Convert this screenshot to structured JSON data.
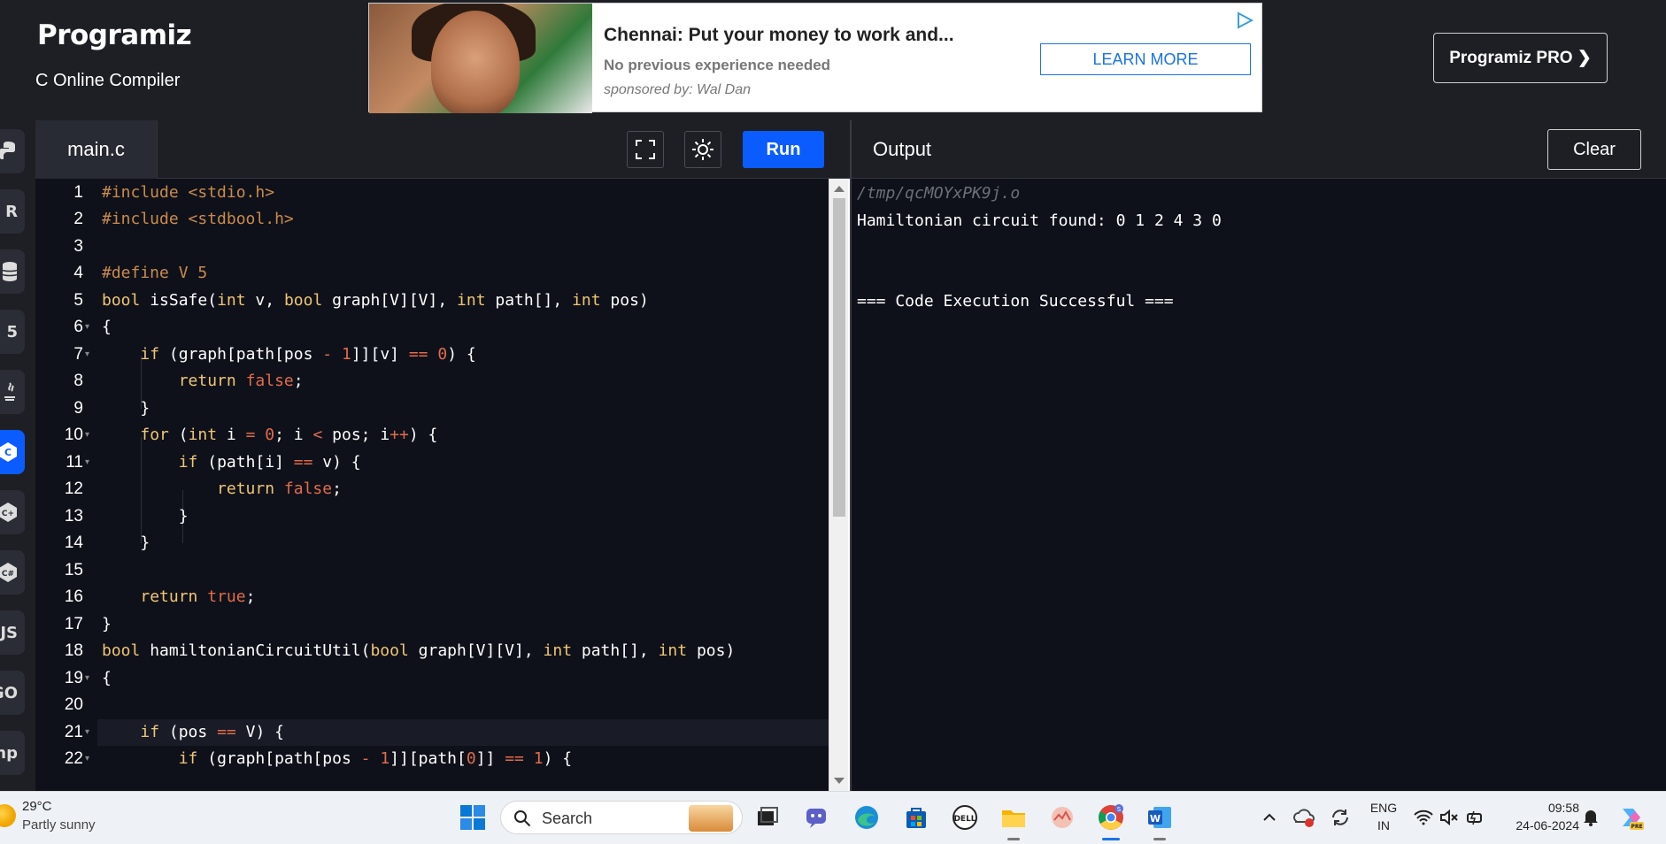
{
  "header": {
    "logo": "Programiz",
    "subtitle": "C Online Compiler",
    "pro_button": "Programiz PRO ❯"
  },
  "ad": {
    "title": "Chennai: Put your money to work and...",
    "subtitle": "No previous experience needed",
    "sponsor": "sponsored by: Wal Dan",
    "cta": "LEARN MORE"
  },
  "rail": {
    "items": [
      "python",
      "r",
      "sql",
      "html",
      "java",
      "c",
      "cpp",
      "csharp",
      "js",
      "go",
      "php"
    ],
    "labels": [
      "",
      "R",
      "",
      "5",
      "",
      "",
      "",
      "",
      "JS",
      "GO",
      "hp"
    ]
  },
  "editor": {
    "file_tab": "main.c",
    "run_label": "Run",
    "line_numbers": [
      "1",
      "2",
      "3",
      "4",
      "5",
      "6",
      "7",
      "8",
      "9",
      "10",
      "11",
      "12",
      "13",
      "14",
      "15",
      "16",
      "17",
      "18",
      "19",
      "20",
      "21",
      "22"
    ],
    "lines": [
      "#include <stdio.h>",
      "#include <stdbool.h>",
      "",
      "#define V 5",
      "bool isSafe(int v, bool graph[V][V], int path[], int pos)",
      "{",
      "    if (graph[path[pos - 1]][v] == 0) {",
      "        return false;",
      "    }",
      "    for (int i = 0; i < pos; i++) {",
      "        if (path[i] == v) {",
      "            return false;",
      "        }",
      "    }",
      "",
      "    return true;",
      "}",
      "bool hamiltonianCircuitUtil(bool graph[V][V], int path[], int pos)",
      "{",
      "",
      "    if (pos == V) {",
      "        if (graph[path[pos - 1]][path[0]] == 1) {"
    ]
  },
  "output": {
    "title": "Output",
    "clear_label": "Clear",
    "lines": [
      "/tmp/qcMOYxPK9j.o",
      "Hamiltonian circuit found: 0 1 2 4 3 0",
      "",
      "",
      "=== Code Execution Successful ==="
    ]
  },
  "taskbar": {
    "weather_temp": "29°C",
    "weather_desc": "Partly sunny",
    "search_placeholder": "Search",
    "lang_top": "ENG",
    "lang_bottom": "IN",
    "time": "09:58",
    "date": "24-06-2024"
  },
  "colors": {
    "accent": "#0b5cff",
    "background": "#0f111a",
    "header": "#1e1f25"
  }
}
